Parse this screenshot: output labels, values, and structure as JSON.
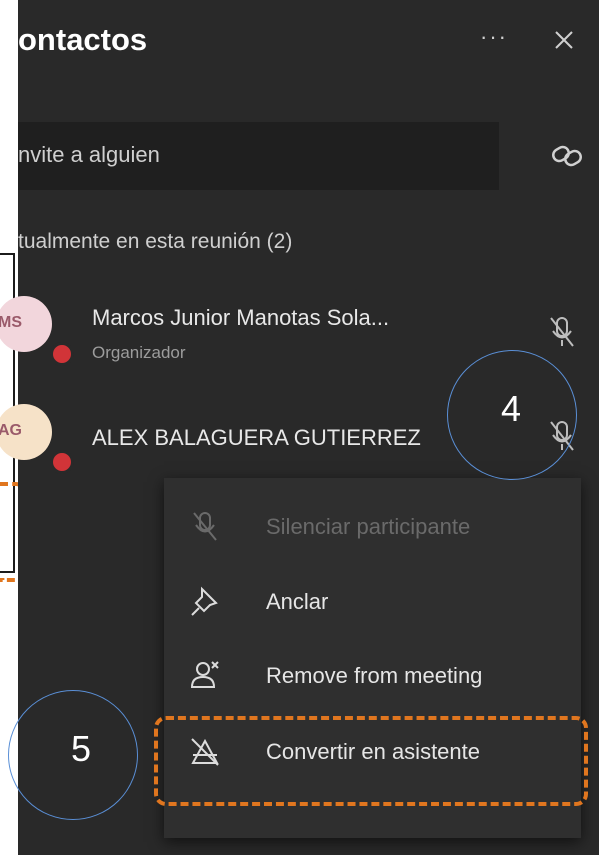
{
  "panel": {
    "title": "ontactos",
    "more_label": "···",
    "search": {
      "text": "nvite a alguien"
    },
    "section_label": "tualmente en esta reunión (2)"
  },
  "participants": [
    {
      "initials": "MS",
      "name": "Marcos Junior Manotas Sola...",
      "role": "Organizador",
      "status_color": "#d13438"
    },
    {
      "initials": "AG",
      "name": "ALEX BALAGUERA GUTIERREZ",
      "status_color": "#d13438"
    }
  ],
  "context_menu": {
    "items": [
      {
        "label": "Silenciar participante",
        "icon": "mic-off-icon",
        "disabled": true
      },
      {
        "label": "Anclar",
        "icon": "pin-icon"
      },
      {
        "label": "Remove from meeting",
        "icon": "remove-person-icon"
      },
      {
        "label": "Convertir en asistente",
        "icon": "attendee-icon"
      }
    ]
  },
  "annotations": {
    "callout_4": "4",
    "callout_5": "5",
    "highlight_color": "#e0761f"
  }
}
